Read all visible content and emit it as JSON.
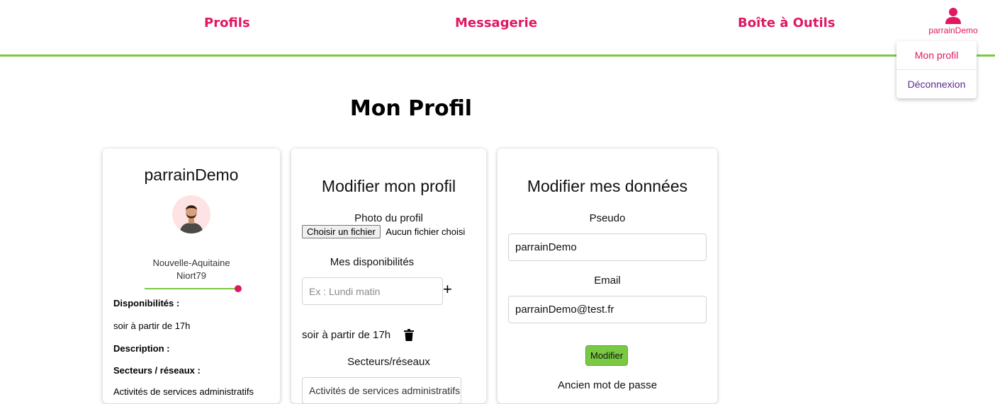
{
  "nav": {
    "profils": "Profils",
    "messagerie": "Messagerie",
    "outils": "Boîte à Outils",
    "username": "parrainDemo"
  },
  "dropdown": {
    "profile": "Mon profil",
    "logout": "Déconnexion"
  },
  "page": {
    "title": "Mon Profil"
  },
  "profile_card": {
    "name": "parrainDemo",
    "region": "Nouvelle-Aquitaine",
    "city": "Niort79",
    "dispo_label": "Disponibilités :",
    "dispo_value": "soir à partir de 17h",
    "description_label": "Description :",
    "sectors_label": "Secteurs / réseaux :",
    "sectors_value": "Activités de services administratifs"
  },
  "edit_profile": {
    "title": "Modifier mon profil",
    "photo_label": "Photo du profil",
    "file_button": "Choisir un fichier",
    "file_status": "Aucun fichier choisi",
    "dispo_label": "Mes disponibilités",
    "dispo_placeholder": "Ex : Lundi matin",
    "add_icon": "+",
    "slot": "soir à partir de 17h",
    "sectors_label": "Secteurs/réseaux",
    "sectors_selected": "Activités de services administratifs"
  },
  "edit_data": {
    "title": "Modifier mes données",
    "pseudo_label": "Pseudo",
    "pseudo_value": "parrainDemo",
    "email_label": "Email",
    "email_value": "parrainDemo@test.fr",
    "modify_button": "Modifier",
    "old_password_label": "Ancien mot de passe"
  },
  "colors": {
    "accent": "#e01763",
    "green": "#7ac943",
    "purple": "#5b2d8e"
  }
}
